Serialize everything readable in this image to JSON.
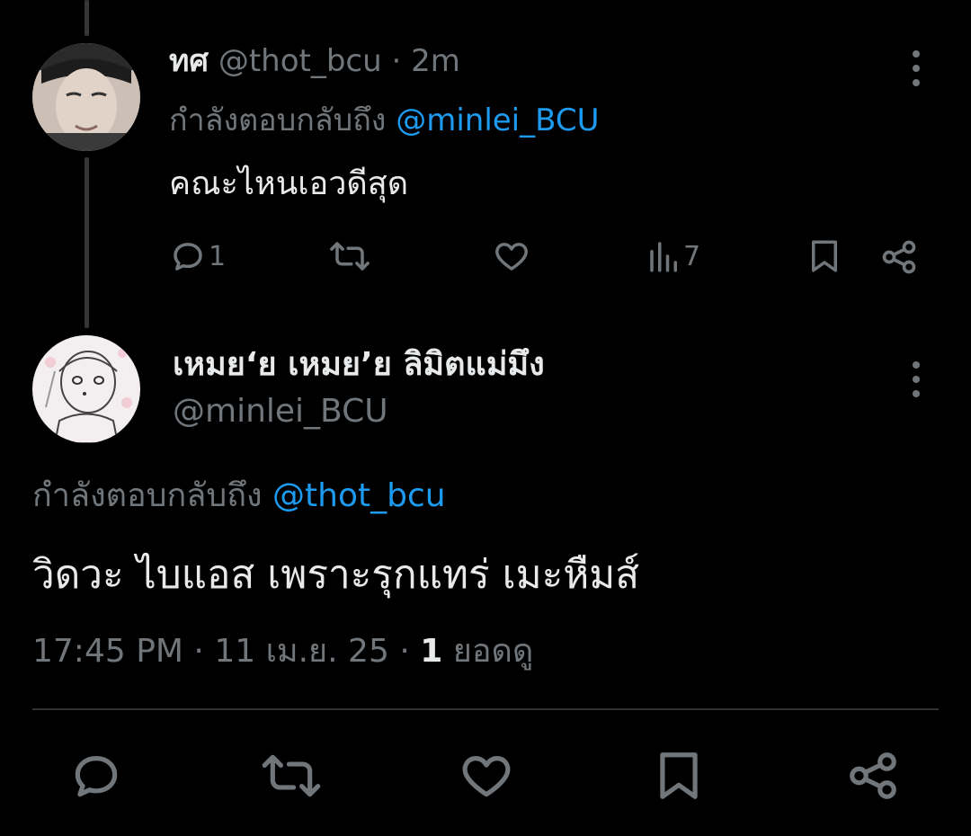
{
  "tweet1": {
    "display_name": "ทศ",
    "handle": "@thot_bcu",
    "separator": "·",
    "time": "2m",
    "replying_prefix": "กำลังตอบกลับถึง",
    "replying_to": "@minlei_BCU",
    "text": "คณะไหนเอวดีสุด",
    "reply_count": "1",
    "view_count": "7"
  },
  "tweet2": {
    "display_name": "เหมย‘ย เหมย’ย ลิมิตแม่มึง",
    "handle": "@minlei_BCU",
    "replying_prefix": "กำลังตอบกลับถึง",
    "replying_to": "@thot_bcu",
    "text": "วิดวะ ไบแอส เพราะรุกแทร่ เมะหืมส์",
    "time": "17:45 PM",
    "date": "11 เม.ย. 25",
    "separator": "·",
    "views_count": "1",
    "views_label": "ยอดดู"
  },
  "colors": {
    "background": "#000000",
    "text": "#e7e9ea",
    "muted": "#71767b",
    "link": "#1d9bf0",
    "divider": "#2f3336"
  },
  "icons": [
    "reply-icon",
    "retweet-icon",
    "like-icon",
    "views-icon",
    "bookmark-icon",
    "share-icon",
    "more-icon"
  ]
}
